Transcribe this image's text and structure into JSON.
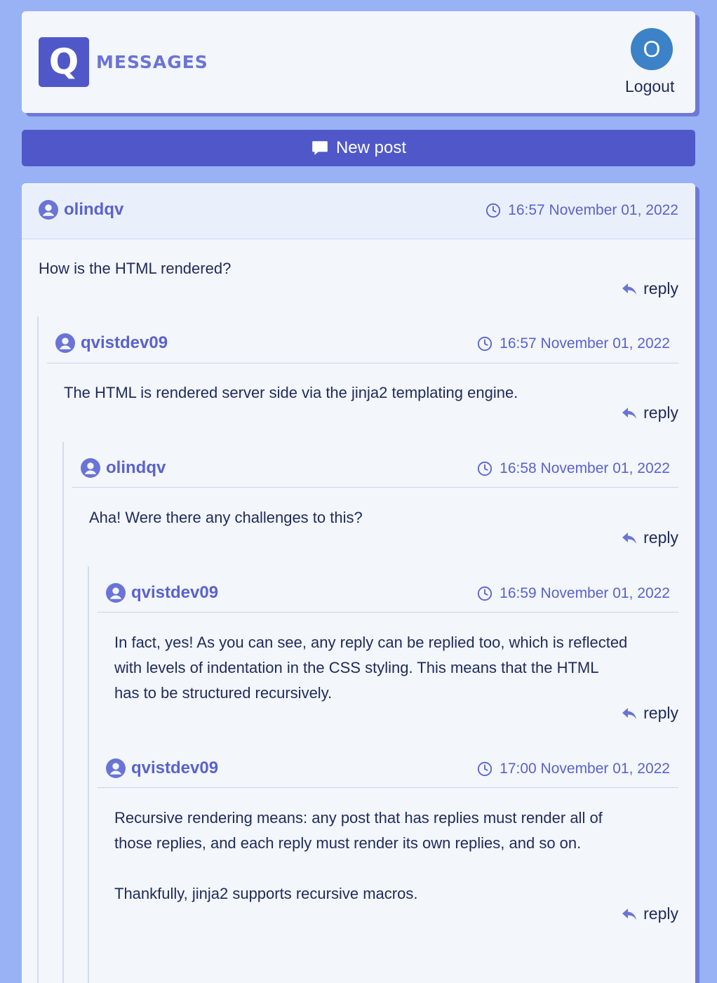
{
  "header": {
    "logo_letter": "Q",
    "title": "MESSAGES",
    "avatar_letter": "O",
    "logout_label": "Logout"
  },
  "new_post_label": "New post",
  "thread": {
    "reply_label": "reply",
    "posts": [
      {
        "author": "olindqv",
        "time": "16:57 November 01, 2022",
        "body": "How is the HTML rendered?"
      },
      {
        "author": "qvistdev09",
        "time": "16:57 November 01, 2022",
        "body": "The HTML is rendered server side via the jinja2 templating engine."
      },
      {
        "author": "olindqv",
        "time": "16:58 November 01, 2022",
        "body": "Aha! Were there any challenges to this?"
      },
      {
        "author": "qvistdev09",
        "time": "16:59 November 01, 2022",
        "body_lines": [
          "In fact, yes! As you can see, any reply can be replied too, which is reflected",
          "with levels of indentation in the CSS styling. This means that the HTML",
          "has to be structured recursively."
        ]
      },
      {
        "author": "qvistdev09",
        "time": "17:00 November 01, 2022",
        "body_lines": [
          "Recursive rendering means: any post that has replies must render all of",
          "those replies, and each reply must render its own replies, and so on.",
          "",
          "Thankfully, jinja2 supports recursive macros."
        ]
      }
    ]
  },
  "colors": {
    "background": "#98b2f5",
    "accent": "#5058c9",
    "card": "#f3f6fa",
    "link": "#5a62cf",
    "avatar": "#3b82c8"
  }
}
